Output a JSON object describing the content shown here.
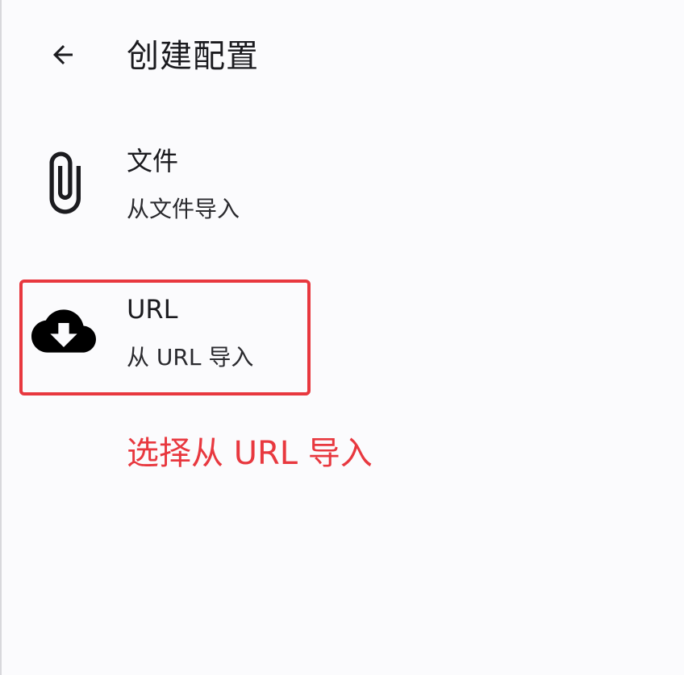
{
  "header": {
    "back_icon": "arrow-left-icon",
    "title": "创建配置"
  },
  "items": [
    {
      "icon": "paperclip-icon",
      "title": "文件",
      "subtitle": "从文件导入"
    },
    {
      "icon": "cloud-download-icon",
      "title": "URL",
      "subtitle": "从 URL 导入"
    }
  ],
  "annotation": {
    "text": "选择从 URL 导入",
    "color": "#e8383f"
  }
}
